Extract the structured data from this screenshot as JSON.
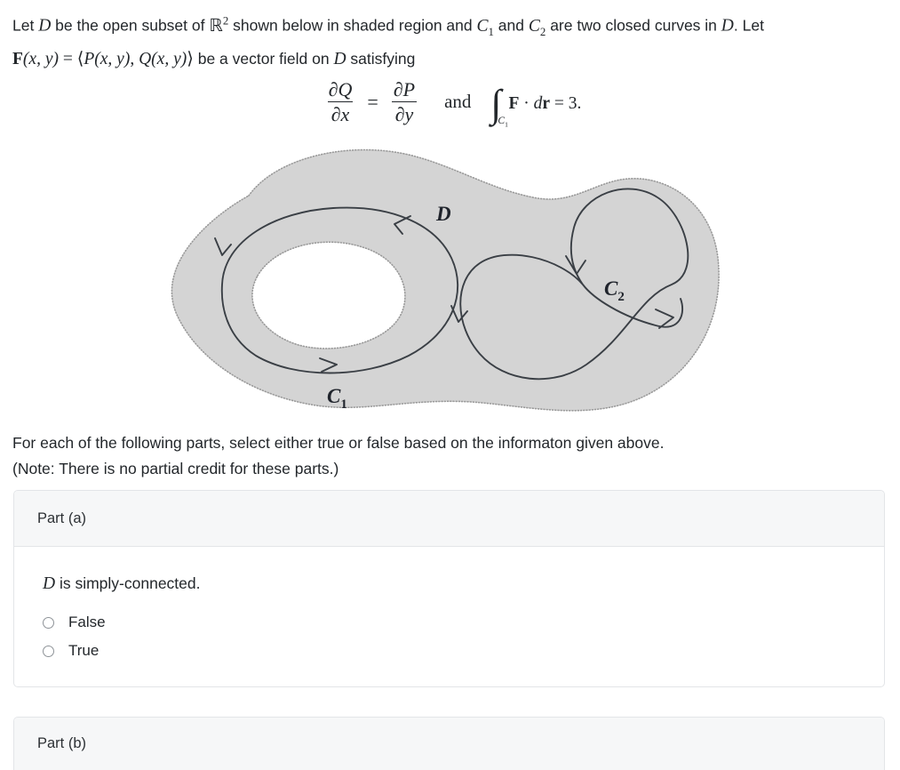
{
  "problem": {
    "line1_a": "Let ",
    "line1_D": "D",
    "line1_b": " be the open subset of ",
    "line1_R": "R",
    "line1_exp": "2",
    "line1_c": " shown below in shaded region and ",
    "line1_C1": "C",
    "line1_C1sub": "1",
    "line1_d": " and ",
    "line1_C2": "C",
    "line1_C2sub": "2",
    "line1_e": " are two closed curves in ",
    "line1_D2": "D",
    "line1_f": ". Let",
    "line2_F": "F",
    "line2_args": "(x, y)",
    "line2_eq": " = ",
    "line2_tuple_open": "⟨",
    "line2_P": "P",
    "line2_Pargs": "(x, y)",
    "line2_comma": ", ",
    "line2_Q": "Q",
    "line2_Qargs": "(x, y)",
    "line2_tuple_close": "⟩",
    "line2_tail": " be a vector field on ",
    "line2_D": "D",
    "line2_tail2": " satisfying"
  },
  "equation": {
    "frac1_num_partial": "∂",
    "frac1_num_var": "Q",
    "frac1_den_partial": "∂",
    "frac1_den_var": "x",
    "equals": "=",
    "frac2_num_partial": "∂",
    "frac2_num_var": "P",
    "frac2_den_partial": "∂",
    "frac2_den_var": "y",
    "and": "and",
    "integral_symbol": "∫",
    "integral_subscript_C": "C",
    "integral_subscript_num": "1",
    "integrand_F": "F",
    "integrand_dot": " · ",
    "integrand_dr_d": "d",
    "integrand_dr_r": "r",
    "integral_equals": " = 3."
  },
  "diagram": {
    "label_D": "D",
    "label_C1": "C",
    "label_C1_sub": "1",
    "label_C2": "C",
    "label_C2_sub": "2",
    "region_fill_color": "#d4d4d4",
    "boundary_color": "#9a9a9a",
    "curve_color": "#3a3f45",
    "label_color": "#20242c"
  },
  "instructions": {
    "line1": "For each of the following parts, select either true or false based on the informaton given above.",
    "line2": "(Note: There is no partial credit for these parts.)"
  },
  "parts": [
    {
      "header": "Part (a)",
      "question_math": "D",
      "question_text": " is simply-connected.",
      "choices": [
        {
          "label": "False",
          "selected": false
        },
        {
          "label": "True",
          "selected": false
        }
      ]
    },
    {
      "header": "Part (b)"
    }
  ]
}
